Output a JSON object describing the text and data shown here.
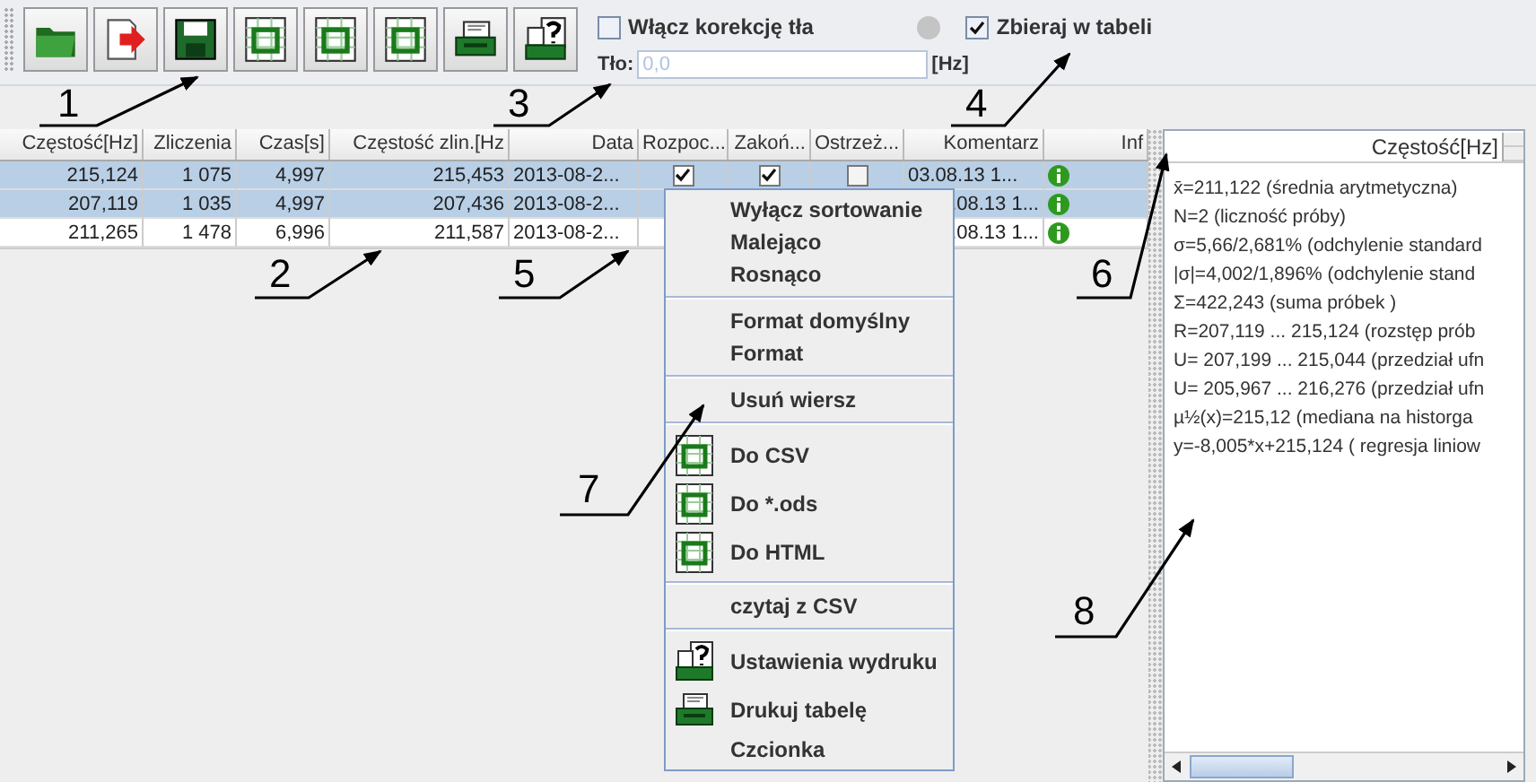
{
  "toolbar": {
    "buttons": [
      {
        "kind": "folder"
      },
      {
        "kind": "import"
      },
      {
        "kind": "save"
      },
      {
        "kind": "sheet"
      },
      {
        "kind": "sheet"
      },
      {
        "kind": "sheet"
      },
      {
        "kind": "print"
      },
      {
        "kind": "print-setup"
      }
    ]
  },
  "options": {
    "correction": {
      "label": "Włącz korekcję tła",
      "checked": false
    },
    "collect": {
      "label": "Zbieraj w tabeli",
      "checked": true
    },
    "background": {
      "label": "Tło:",
      "placeholder": "0,0",
      "unit": "[Hz]"
    }
  },
  "table": {
    "columns": [
      "Częstość[Hz]",
      "Zliczenia",
      "Czas[s]",
      "Częstość zlin.[Hz",
      "Data",
      "Rozpoc...",
      "Zakoń...",
      "Ostrzeż...",
      "Komentarz",
      "Inf"
    ],
    "rows": [
      {
        "selected": true,
        "cells": [
          {
            "kind": "num",
            "text": "215,124"
          },
          {
            "kind": "num",
            "text": "1 075"
          },
          {
            "kind": "num",
            "text": "4,997"
          },
          {
            "kind": "num",
            "text": "215,453"
          },
          {
            "kind": "text",
            "text": "2013-08-2..."
          },
          {
            "kind": "check",
            "checked": true
          },
          {
            "kind": "check",
            "checked": true
          },
          {
            "kind": "check",
            "checked": false
          },
          {
            "kind": "text",
            "text": "03.08.13 1..."
          },
          {
            "kind": "info"
          }
        ]
      },
      {
        "selected": true,
        "cells": [
          {
            "kind": "num",
            "text": "207,119"
          },
          {
            "kind": "num",
            "text": "1 035"
          },
          {
            "kind": "num",
            "text": "4,997"
          },
          {
            "kind": "num",
            "text": "207,436"
          },
          {
            "kind": "text",
            "text": "2013-08-2..."
          },
          null,
          null,
          null,
          {
            "kind": "right",
            "text": ".08.13 1..."
          },
          {
            "kind": "info"
          }
        ]
      },
      {
        "selected": false,
        "cells": [
          {
            "kind": "num",
            "text": "211,265"
          },
          {
            "kind": "num",
            "text": "1 478"
          },
          {
            "kind": "num",
            "text": "6,996"
          },
          {
            "kind": "num",
            "text": "211,587"
          },
          {
            "kind": "text",
            "text": "2013-08-2..."
          },
          null,
          null,
          null,
          {
            "kind": "right",
            "text": ".08.13 1..."
          },
          {
            "kind": "info"
          }
        ]
      }
    ]
  },
  "stats": {
    "header": "Częstość[Hz]",
    "lines": [
      "x̄=211,122 (średnia arytmetyczna)",
      "N=2 (liczność próby)",
      "σ=5,66/2,681% (odchylenie standard",
      "|σ|=4,002/1,896% (odchylenie stand",
      "Σ=422,243 (suma próbek )",
      "R=207,119 ... 215,124 (rozstęp prób",
      "U= 207,199 ... 215,044 (przedział ufn",
      "U= 205,967 ... 216,276 (przedział ufn",
      "µ½(x)=215,12 (mediana na historga",
      "y=-8,005*x+215,124 ( regresja liniow"
    ]
  },
  "context_menu": [
    {
      "kind": "item",
      "label": "Wyłącz sortowanie"
    },
    {
      "kind": "item",
      "label": "Malejąco"
    },
    {
      "kind": "item",
      "label": "Rosnąco"
    },
    {
      "kind": "separator"
    },
    {
      "kind": "item",
      "label": "Format domyślny"
    },
    {
      "kind": "item",
      "label": "Format"
    },
    {
      "kind": "separator"
    },
    {
      "kind": "item",
      "label": "Usuń wiersz"
    },
    {
      "kind": "separator"
    },
    {
      "kind": "export",
      "label": "Do CSV"
    },
    {
      "kind": "export",
      "label": "Do *.ods"
    },
    {
      "kind": "export",
      "label": "Do HTML"
    },
    {
      "kind": "separator"
    },
    {
      "kind": "item",
      "label": "czytaj z CSV"
    },
    {
      "kind": "separator"
    },
    {
      "kind": "setup",
      "label": "Ustawienia wydruku"
    },
    {
      "kind": "print",
      "label": "Drukuj tabelę"
    },
    {
      "kind": "item",
      "label": "Czcionka"
    }
  ],
  "callouts": [
    "1",
    "2",
    "3",
    "4",
    "5",
    "6",
    "7",
    "8"
  ]
}
